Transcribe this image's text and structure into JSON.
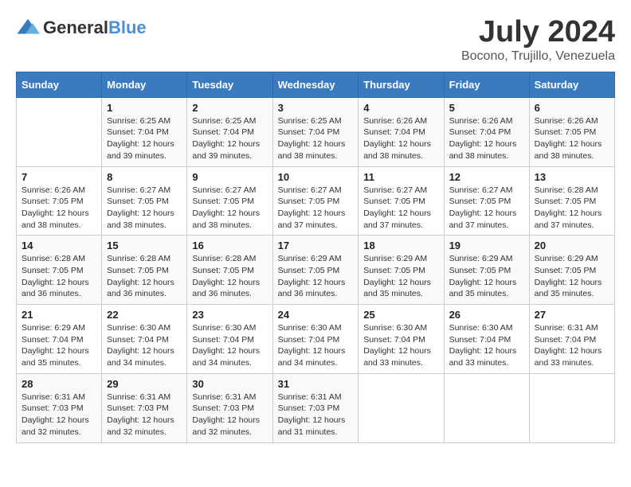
{
  "logo": {
    "general": "General",
    "blue": "Blue"
  },
  "title": "July 2024",
  "location": "Bocono, Trujillo, Venezuela",
  "days_of_week": [
    "Sunday",
    "Monday",
    "Tuesday",
    "Wednesday",
    "Thursday",
    "Friday",
    "Saturday"
  ],
  "weeks": [
    [
      {
        "day": "",
        "sunrise": "",
        "sunset": "",
        "daylight": ""
      },
      {
        "day": "1",
        "sunrise": "Sunrise: 6:25 AM",
        "sunset": "Sunset: 7:04 PM",
        "daylight": "Daylight: 12 hours and 39 minutes."
      },
      {
        "day": "2",
        "sunrise": "Sunrise: 6:25 AM",
        "sunset": "Sunset: 7:04 PM",
        "daylight": "Daylight: 12 hours and 39 minutes."
      },
      {
        "day": "3",
        "sunrise": "Sunrise: 6:25 AM",
        "sunset": "Sunset: 7:04 PM",
        "daylight": "Daylight: 12 hours and 38 minutes."
      },
      {
        "day": "4",
        "sunrise": "Sunrise: 6:26 AM",
        "sunset": "Sunset: 7:04 PM",
        "daylight": "Daylight: 12 hours and 38 minutes."
      },
      {
        "day": "5",
        "sunrise": "Sunrise: 6:26 AM",
        "sunset": "Sunset: 7:04 PM",
        "daylight": "Daylight: 12 hours and 38 minutes."
      },
      {
        "day": "6",
        "sunrise": "Sunrise: 6:26 AM",
        "sunset": "Sunset: 7:05 PM",
        "daylight": "Daylight: 12 hours and 38 minutes."
      }
    ],
    [
      {
        "day": "7",
        "sunrise": "Sunrise: 6:26 AM",
        "sunset": "Sunset: 7:05 PM",
        "daylight": "Daylight: 12 hours and 38 minutes."
      },
      {
        "day": "8",
        "sunrise": "Sunrise: 6:27 AM",
        "sunset": "Sunset: 7:05 PM",
        "daylight": "Daylight: 12 hours and 38 minutes."
      },
      {
        "day": "9",
        "sunrise": "Sunrise: 6:27 AM",
        "sunset": "Sunset: 7:05 PM",
        "daylight": "Daylight: 12 hours and 38 minutes."
      },
      {
        "day": "10",
        "sunrise": "Sunrise: 6:27 AM",
        "sunset": "Sunset: 7:05 PM",
        "daylight": "Daylight: 12 hours and 37 minutes."
      },
      {
        "day": "11",
        "sunrise": "Sunrise: 6:27 AM",
        "sunset": "Sunset: 7:05 PM",
        "daylight": "Daylight: 12 hours and 37 minutes."
      },
      {
        "day": "12",
        "sunrise": "Sunrise: 6:27 AM",
        "sunset": "Sunset: 7:05 PM",
        "daylight": "Daylight: 12 hours and 37 minutes."
      },
      {
        "day": "13",
        "sunrise": "Sunrise: 6:28 AM",
        "sunset": "Sunset: 7:05 PM",
        "daylight": "Daylight: 12 hours and 37 minutes."
      }
    ],
    [
      {
        "day": "14",
        "sunrise": "Sunrise: 6:28 AM",
        "sunset": "Sunset: 7:05 PM",
        "daylight": "Daylight: 12 hours and 36 minutes."
      },
      {
        "day": "15",
        "sunrise": "Sunrise: 6:28 AM",
        "sunset": "Sunset: 7:05 PM",
        "daylight": "Daylight: 12 hours and 36 minutes."
      },
      {
        "day": "16",
        "sunrise": "Sunrise: 6:28 AM",
        "sunset": "Sunset: 7:05 PM",
        "daylight": "Daylight: 12 hours and 36 minutes."
      },
      {
        "day": "17",
        "sunrise": "Sunrise: 6:29 AM",
        "sunset": "Sunset: 7:05 PM",
        "daylight": "Daylight: 12 hours and 36 minutes."
      },
      {
        "day": "18",
        "sunrise": "Sunrise: 6:29 AM",
        "sunset": "Sunset: 7:05 PM",
        "daylight": "Daylight: 12 hours and 35 minutes."
      },
      {
        "day": "19",
        "sunrise": "Sunrise: 6:29 AM",
        "sunset": "Sunset: 7:05 PM",
        "daylight": "Daylight: 12 hours and 35 minutes."
      },
      {
        "day": "20",
        "sunrise": "Sunrise: 6:29 AM",
        "sunset": "Sunset: 7:05 PM",
        "daylight": "Daylight: 12 hours and 35 minutes."
      }
    ],
    [
      {
        "day": "21",
        "sunrise": "Sunrise: 6:29 AM",
        "sunset": "Sunset: 7:04 PM",
        "daylight": "Daylight: 12 hours and 35 minutes."
      },
      {
        "day": "22",
        "sunrise": "Sunrise: 6:30 AM",
        "sunset": "Sunset: 7:04 PM",
        "daylight": "Daylight: 12 hours and 34 minutes."
      },
      {
        "day": "23",
        "sunrise": "Sunrise: 6:30 AM",
        "sunset": "Sunset: 7:04 PM",
        "daylight": "Daylight: 12 hours and 34 minutes."
      },
      {
        "day": "24",
        "sunrise": "Sunrise: 6:30 AM",
        "sunset": "Sunset: 7:04 PM",
        "daylight": "Daylight: 12 hours and 34 minutes."
      },
      {
        "day": "25",
        "sunrise": "Sunrise: 6:30 AM",
        "sunset": "Sunset: 7:04 PM",
        "daylight": "Daylight: 12 hours and 33 minutes."
      },
      {
        "day": "26",
        "sunrise": "Sunrise: 6:30 AM",
        "sunset": "Sunset: 7:04 PM",
        "daylight": "Daylight: 12 hours and 33 minutes."
      },
      {
        "day": "27",
        "sunrise": "Sunrise: 6:31 AM",
        "sunset": "Sunset: 7:04 PM",
        "daylight": "Daylight: 12 hours and 33 minutes."
      }
    ],
    [
      {
        "day": "28",
        "sunrise": "Sunrise: 6:31 AM",
        "sunset": "Sunset: 7:03 PM",
        "daylight": "Daylight: 12 hours and 32 minutes."
      },
      {
        "day": "29",
        "sunrise": "Sunrise: 6:31 AM",
        "sunset": "Sunset: 7:03 PM",
        "daylight": "Daylight: 12 hours and 32 minutes."
      },
      {
        "day": "30",
        "sunrise": "Sunrise: 6:31 AM",
        "sunset": "Sunset: 7:03 PM",
        "daylight": "Daylight: 12 hours and 32 minutes."
      },
      {
        "day": "31",
        "sunrise": "Sunrise: 6:31 AM",
        "sunset": "Sunset: 7:03 PM",
        "daylight": "Daylight: 12 hours and 31 minutes."
      },
      {
        "day": "",
        "sunrise": "",
        "sunset": "",
        "daylight": ""
      },
      {
        "day": "",
        "sunrise": "",
        "sunset": "",
        "daylight": ""
      },
      {
        "day": "",
        "sunrise": "",
        "sunset": "",
        "daylight": ""
      }
    ]
  ]
}
